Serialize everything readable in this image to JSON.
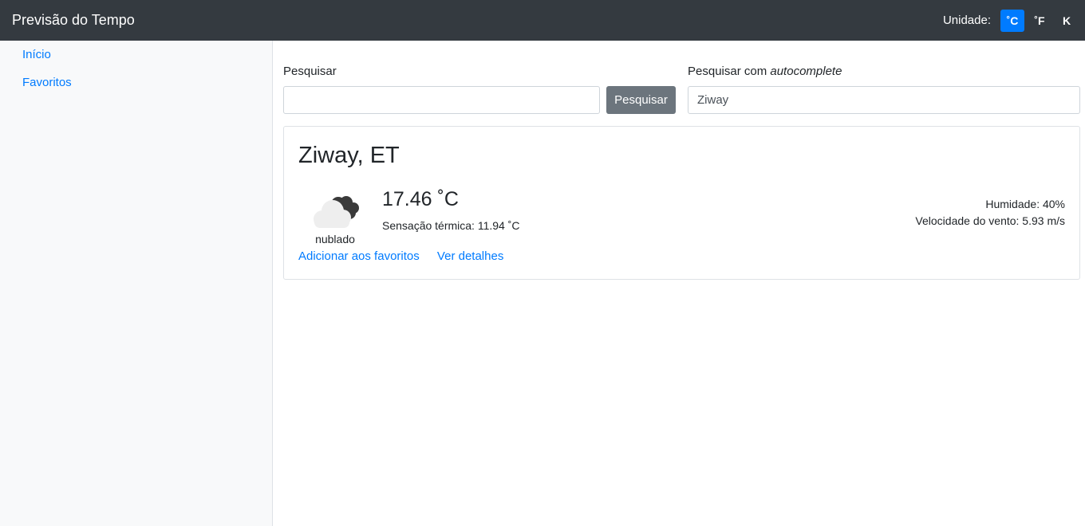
{
  "navbar": {
    "title": "Previsão do Tempo",
    "unit_label": "Unidade:",
    "units": [
      "˚C",
      "˚F",
      "K"
    ],
    "active_unit": "˚C"
  },
  "sidebar": {
    "items": [
      {
        "label": "Início"
      },
      {
        "label": "Favoritos"
      }
    ]
  },
  "search": {
    "label": "Pesquisar",
    "value": "",
    "button_label": "Pesquisar"
  },
  "autocomplete": {
    "label_prefix": "Pesquisar com ",
    "label_emphasis": "autocomplete",
    "value": "Ziway"
  },
  "weather": {
    "city": "Ziway, ET",
    "icon": "cloudy-icon",
    "condition": "nublado",
    "temperature": "17.46 ˚C",
    "feels_like": "Sensação térmica: 11.94 ˚C",
    "humidity": "Humidade: 40%",
    "wind": "Velocidade do vento: 5.93 m/s",
    "favorite_link": "Adicionar aos favoritos",
    "details_link": "Ver detalhes"
  },
  "colors": {
    "navbar_bg": "#343a40",
    "accent": "#007bff",
    "button_secondary": "#6c757d",
    "sidebar_bg": "#f8f9fa"
  }
}
